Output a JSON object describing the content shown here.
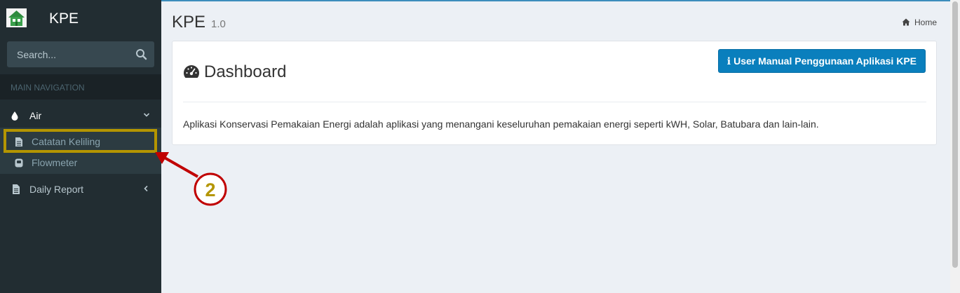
{
  "app": {
    "name": "KPE"
  },
  "search": {
    "placeholder": "Search..."
  },
  "sidebar": {
    "nav_header": "MAIN NAVIGATION",
    "items": [
      {
        "label": "Air",
        "icon": "droplet-icon",
        "expanded": true,
        "children": [
          {
            "label": "Catatan Keliling",
            "icon": "file-icon"
          },
          {
            "label": "Flowmeter",
            "icon": "gauge-icon"
          }
        ]
      },
      {
        "label": "Daily Report",
        "icon": "file-icon",
        "expanded": false
      }
    ]
  },
  "header": {
    "title": "KPE",
    "version": "1.0",
    "breadcrumb": "Home"
  },
  "box": {
    "title": "Dashboard",
    "button_label": "User Manual Penggunaan Aplikasi KPE",
    "description": "Aplikasi Konservasi Pemakaian Energi adalah aplikasi yang menangani keseluruhan pemakaian energi seperti kWH, Solar, Batubara dan lain-lain."
  },
  "annotation": {
    "number": "2",
    "color": "#c00000",
    "highlight_color": "#b49500"
  },
  "colors": {
    "sidebar": "#222d32",
    "accent": "#3c8dbc",
    "button": "#0a7fbd"
  }
}
